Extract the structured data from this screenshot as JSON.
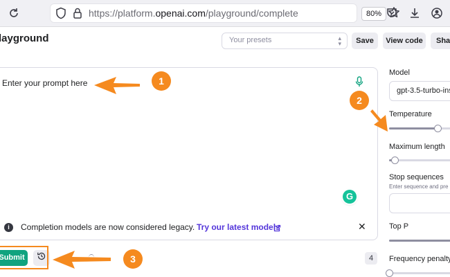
{
  "browser": {
    "url_prefix": "https://platform.",
    "url_domain": "openai.com",
    "url_path": "/playground/complete",
    "zoom": "80%"
  },
  "header": {
    "title": "layground",
    "presets_placeholder": "Your presets",
    "save_label": "Save",
    "view_code_label": "View code",
    "share_label": "Shar"
  },
  "editor": {
    "prompt_placeholder": "Enter your prompt here",
    "legacy_notice": "Completion models are now considered legacy.",
    "legacy_link": "Try our latest models",
    "close_symbol": "✕",
    "grammarly_letter": "G"
  },
  "footer": {
    "submit_label": "Submit",
    "token_count": "4"
  },
  "settings": {
    "model_label": "Model",
    "model_value": "gpt-3.5-turbo-ins",
    "temperature_label": "Temperature",
    "temperature_level": 0.7,
    "max_length_label": "Maximum length",
    "max_length_level": 0.08,
    "stop_sequences_label": "Stop sequences",
    "stop_sequences_hint": "Enter sequence and pre",
    "top_p_label": "Top P",
    "frequency_penalty_label": "Frequency penalty"
  },
  "annotations": {
    "badge_1": "1",
    "badge_2": "2",
    "badge_3": "3",
    "accent_color": "#f58a1f"
  },
  "colors": {
    "submit_green": "#10a37f",
    "link_purple": "#5436da",
    "grammarly_green": "#15c39a"
  },
  "icons": [
    "reload-icon",
    "shield-icon",
    "lock-icon",
    "star-icon",
    "pocket-icon",
    "download-icon",
    "account-icon",
    "microphone-icon",
    "info-icon",
    "external-link-icon",
    "close-icon",
    "history-icon",
    "grammarly-icon"
  ]
}
